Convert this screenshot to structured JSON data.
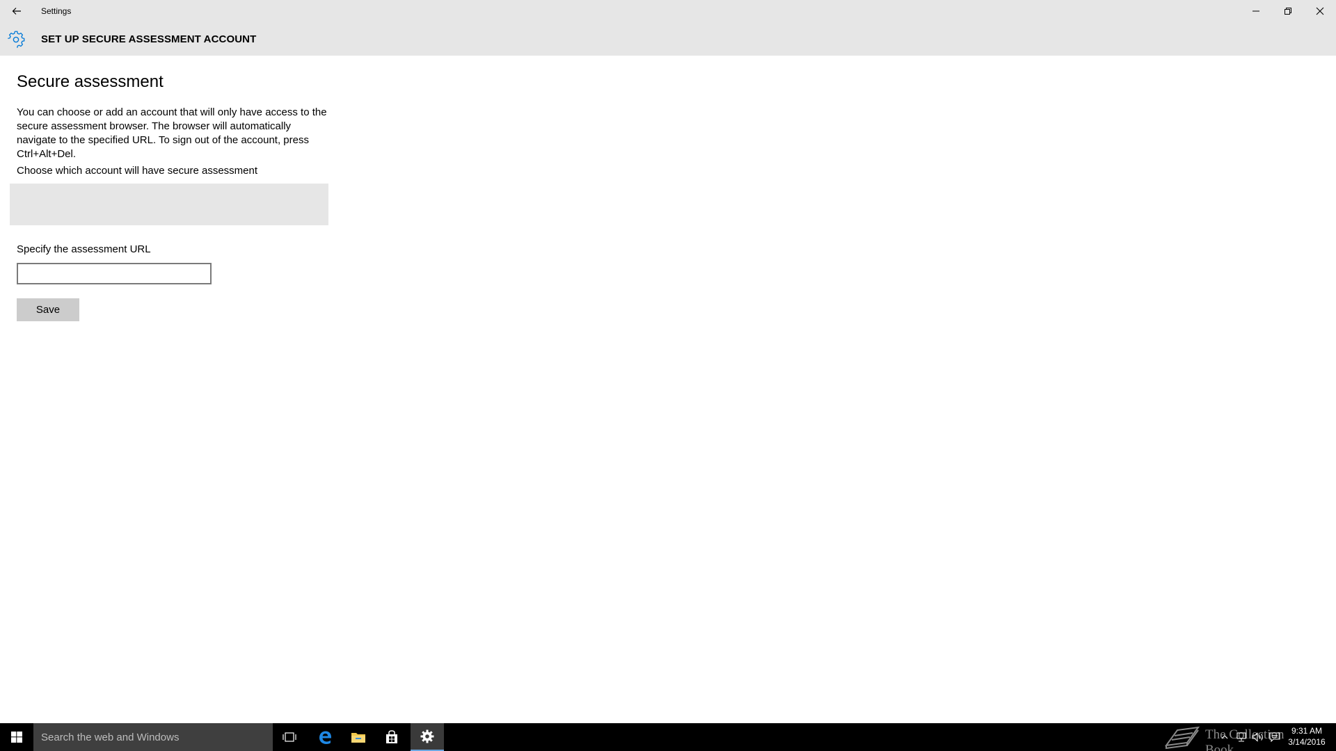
{
  "window": {
    "title": "Settings"
  },
  "header": {
    "title": "SET UP SECURE ASSESSMENT ACCOUNT"
  },
  "content": {
    "section_title": "Secure assessment",
    "description": "You can choose or add an account that will only have access to the secure assessment browser. The browser will automatically navigate to the specified URL. To sign out of the account, press Ctrl+Alt+Del.",
    "choose_label": "Choose which account will have secure assessment",
    "url_label": "Specify the assessment URL",
    "url_value": "",
    "save_label": "Save"
  },
  "taskbar": {
    "search_placeholder": "Search the web and Windows",
    "watermark": "The Collection Book",
    "clock_time": "9:31 AM",
    "clock_date": "3/14/2016"
  },
  "colors": {
    "accent": "#0078d7",
    "chrome": "#e6e6e6",
    "taskbar": "#000000"
  },
  "icons": [
    "back-arrow-icon",
    "minimize-icon",
    "maximize-icon",
    "close-icon",
    "gear-icon",
    "windows-logo-icon",
    "task-view-icon",
    "edge-icon",
    "file-explorer-icon",
    "store-icon",
    "settings-gear-icon",
    "chevron-up-icon",
    "network-icon",
    "volume-icon",
    "action-center-icon"
  ]
}
